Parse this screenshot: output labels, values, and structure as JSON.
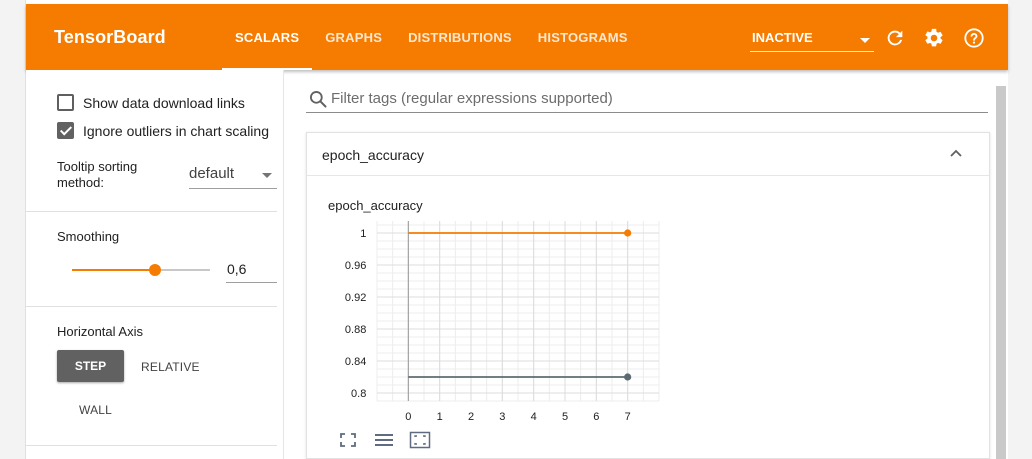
{
  "app": {
    "title": "TensorBoard"
  },
  "tabs": [
    {
      "label": "SCALARS",
      "active": true
    },
    {
      "label": "GRAPHS",
      "active": false
    },
    {
      "label": "DISTRIBUTIONS",
      "active": false
    },
    {
      "label": "HISTOGRAMS",
      "active": false
    }
  ],
  "run_select": {
    "value": "INACTIVE"
  },
  "toolbar_icons": {
    "refresh": "refresh-icon",
    "settings": "gear-icon",
    "help": "help-icon"
  },
  "sidebar": {
    "show_download_links": {
      "label": "Show data download links",
      "checked": false
    },
    "ignore_outliers": {
      "label": "Ignore outliers in chart scaling",
      "checked": true
    },
    "tooltip_sorting": {
      "label": "Tooltip sorting method:",
      "value": "default"
    },
    "smoothing": {
      "title": "Smoothing",
      "value": "0,6",
      "level": 0.6
    },
    "horizontal_axis": {
      "title": "Horizontal Axis",
      "step": "STEP",
      "relative": "RELATIVE",
      "wall": "WALL"
    }
  },
  "search": {
    "placeholder": "Filter tags (regular expressions supported)"
  },
  "card": {
    "title": "epoch_accuracy"
  },
  "colors": {
    "accent": "#f57c00",
    "series_orange": "#f57c00",
    "series_gray": "#5f6b73"
  },
  "chart_data": {
    "type": "line",
    "title": "epoch_accuracy",
    "x_ticks": [
      "0",
      "1",
      "2",
      "3",
      "4",
      "5",
      "6",
      "7"
    ],
    "y_ticks": [
      "0.8",
      "0.84",
      "0.88",
      "0.92",
      "0.96",
      "1"
    ],
    "xlim": [
      -1,
      8
    ],
    "ylim": [
      0.79,
      1.015
    ],
    "grid": true,
    "series": [
      {
        "color": "#f57c00",
        "x": [
          0,
          7
        ],
        "y": [
          1.0,
          1.0
        ]
      },
      {
        "color": "#5f6b73",
        "x": [
          0,
          7
        ],
        "y": [
          0.82,
          0.82
        ]
      }
    ]
  }
}
